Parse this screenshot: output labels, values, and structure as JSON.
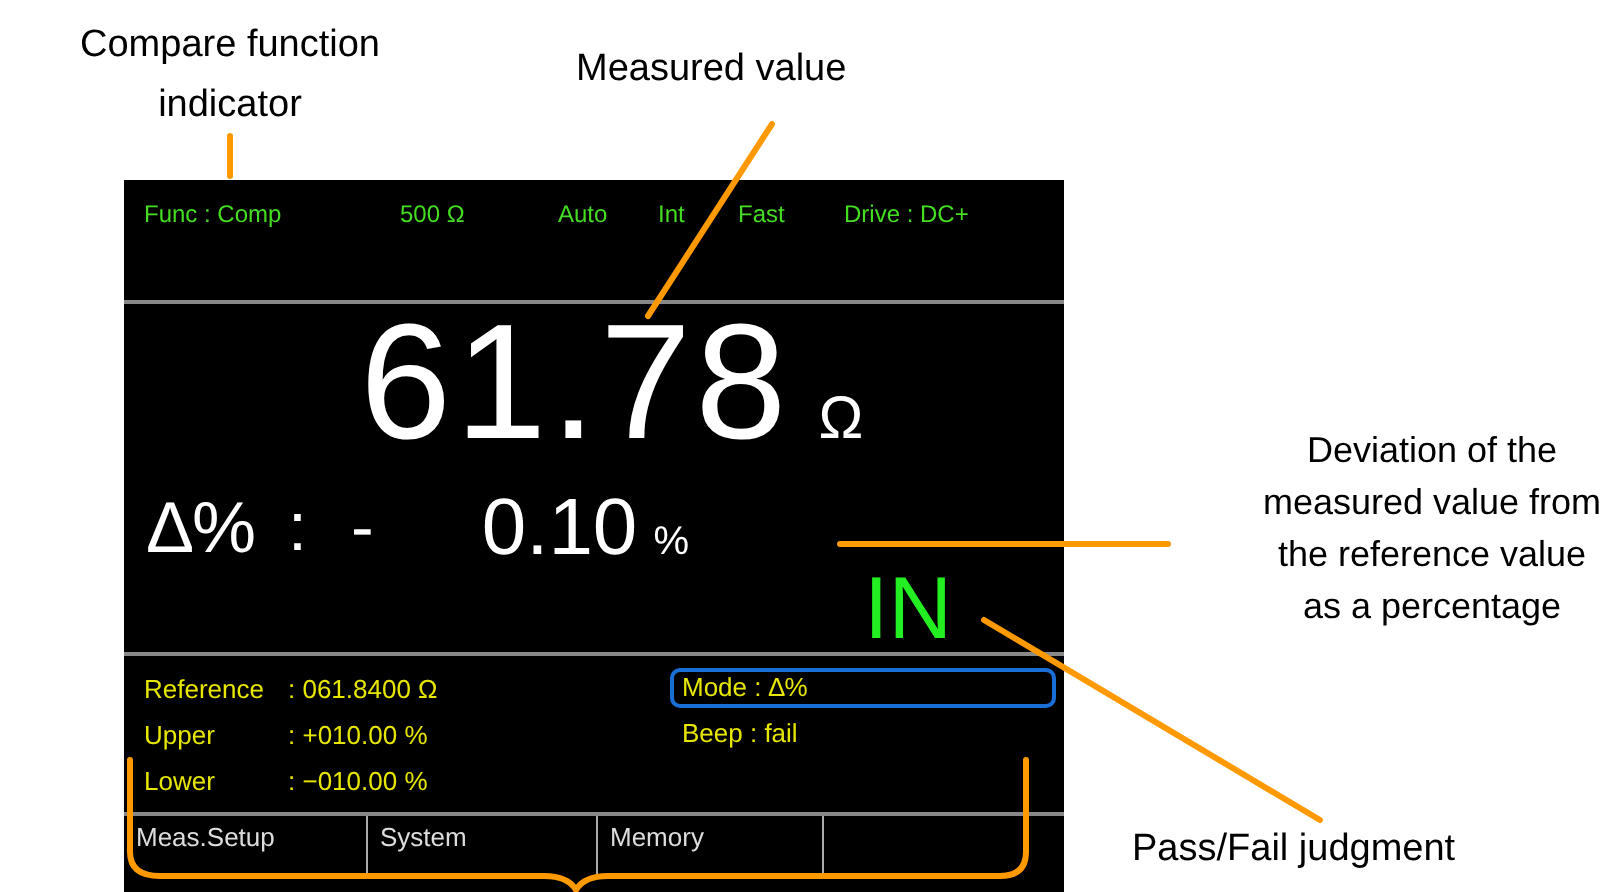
{
  "screen": {
    "status_bar": [
      "Func : Comp",
      "500 Ω",
      "Auto",
      "Int",
      "Fast",
      "Drive : DC+"
    ],
    "measurement": {
      "value": "61.78",
      "unit": "Ω"
    },
    "deviation": {
      "label": "∆%",
      "colon": ":",
      "sign": "-",
      "value": "0.10",
      "unit": "%"
    },
    "judgment": {
      "text": "IN",
      "pass": true
    },
    "settings": [
      {
        "label": "Reference",
        "value": ": 061.8400 Ω"
      },
      {
        "label": "Upper",
        "value": ": +010.00 %"
      },
      {
        "label": "Lower",
        "value": ": −010.00 %"
      }
    ],
    "options": [
      {
        "text": "Mode : ∆%",
        "selected": true
      },
      {
        "text": "Beep : fail",
        "selected": false
      }
    ],
    "softkeys": [
      "Meas.Setup",
      "System",
      "Memory"
    ]
  },
  "annotations": [
    "Compare function indicator",
    "Measured value",
    "Deviation of the measured value from the reference value as a percentage",
    "Pass/Fail judgment"
  ]
}
